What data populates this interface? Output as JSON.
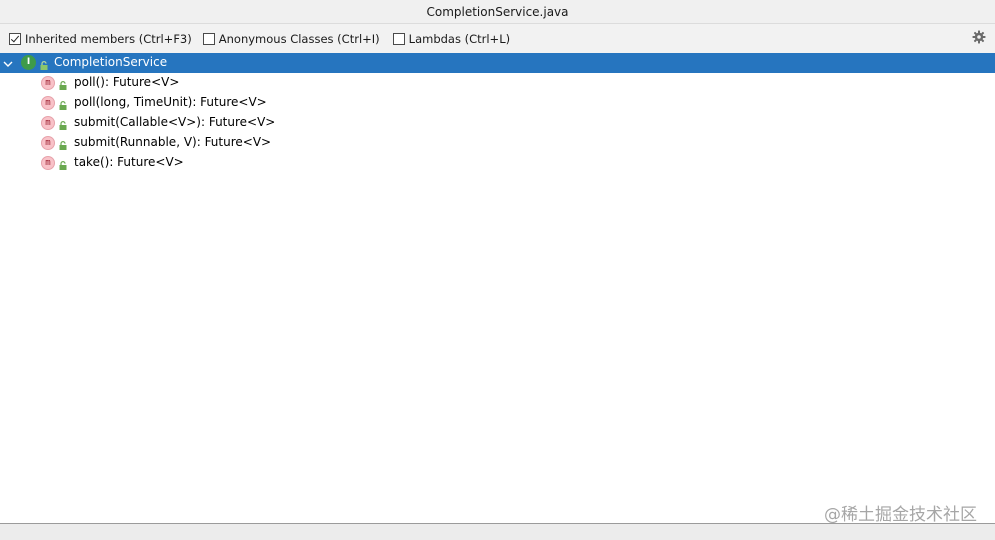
{
  "window": {
    "title": "CompletionService.java"
  },
  "toolbar": {
    "inherited": {
      "label": "Inherited members (Ctrl+F3)",
      "checked": true
    },
    "anonymous": {
      "label": "Anonymous Classes (Ctrl+I)",
      "checked": false
    },
    "lambdas": {
      "label": "Lambdas (Ctrl+L)",
      "checked": false
    },
    "settings_icon": "gear-icon"
  },
  "tree": {
    "root": {
      "label": "CompletionService",
      "icon_letter": "I",
      "expanded": true,
      "selected": true
    },
    "methods": [
      {
        "label": "poll(): Future<V>",
        "icon_letter": "m"
      },
      {
        "label": "poll(long, TimeUnit): Future<V>",
        "icon_letter": "m"
      },
      {
        "label": "submit(Callable<V>): Future<V>",
        "icon_letter": "m"
      },
      {
        "label": "submit(Runnable, V): Future<V>",
        "icon_letter": "m"
      },
      {
        "label": "take(): Future<V>",
        "icon_letter": "m"
      }
    ]
  },
  "watermark": "@稀土掘金技术社区",
  "colors": {
    "selection": "#2675bf",
    "interface_icon": "#3e9b4a",
    "method_icon": "#f8c2c8",
    "lock": "#6aa84f"
  }
}
